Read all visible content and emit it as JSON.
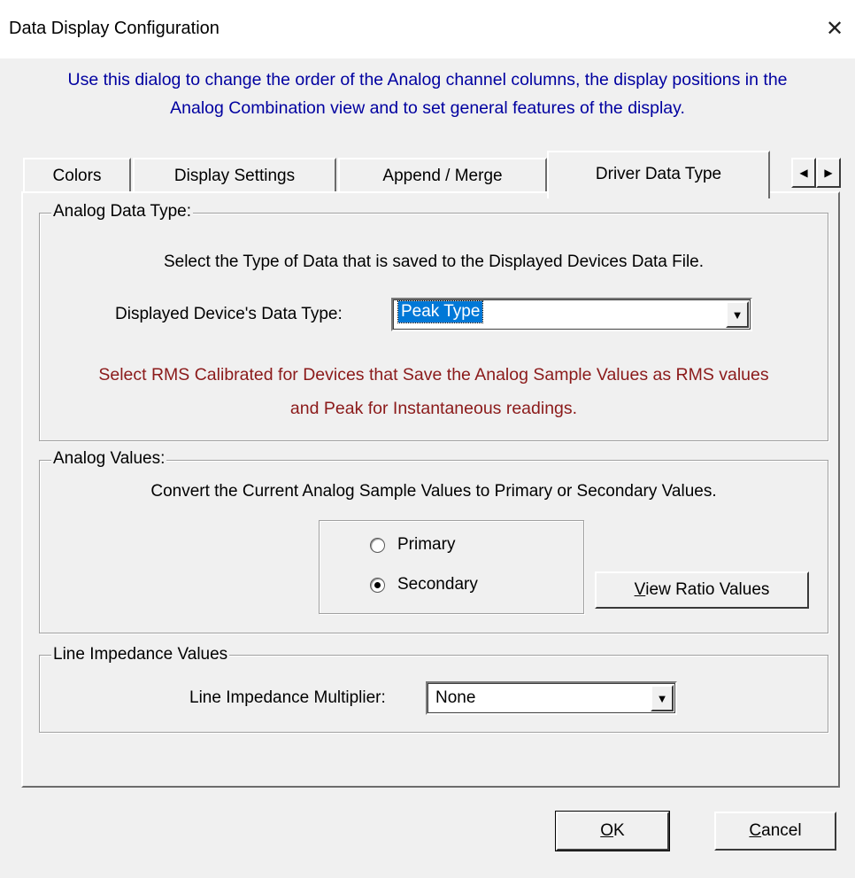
{
  "window": {
    "title": "Data Display Configuration",
    "close_icon": "close-icon"
  },
  "intro": {
    "line1": "Use this dialog to change the order of the Analog channel columns, the display positions in the",
    "line2": "Analog Combination view and to set general features of the display."
  },
  "tabs": [
    {
      "label": "Colors",
      "active": false
    },
    {
      "label": "Display Settings",
      "active": false
    },
    {
      "label": "Append / Merge",
      "active": false
    },
    {
      "label": "Driver Data Type",
      "active": true
    }
  ],
  "tab_scroll": {
    "left_icon": "arrow-left-icon",
    "right_icon": "arrow-right-icon"
  },
  "analog_data_type": {
    "group_label": "Analog Data Type:",
    "description": "Select the Type of Data that is saved to the Displayed Devices Data File.",
    "field_label": "Displayed Device's Data Type:",
    "selected_value": "Peak Type",
    "note_line1": "Select RMS Calibrated for Devices that Save the Analog Sample Values as RMS values",
    "note_line2": "and Peak for Instantaneous readings."
  },
  "analog_values": {
    "group_label": "Analog Values:",
    "description": "Convert the Current Analog Sample Values to Primary or Secondary Values.",
    "options": [
      {
        "label": "Primary",
        "checked": false
      },
      {
        "label": "Secondary",
        "checked": true
      }
    ],
    "view_ratio_button": {
      "prefix": "",
      "accel": "V",
      "rest": "iew Ratio Values"
    }
  },
  "line_impedance": {
    "group_label": "Line Impedance Values",
    "field_label": "Line Impedance Multiplier:",
    "selected_value": "None"
  },
  "buttons": {
    "ok": {
      "accel": "O",
      "rest": "K"
    },
    "cancel": {
      "accel": "C",
      "rest": "ancel"
    }
  },
  "colors": {
    "intro_text": "#0000a0",
    "note_text": "#8b1a1a",
    "selection": "#0078d7"
  }
}
